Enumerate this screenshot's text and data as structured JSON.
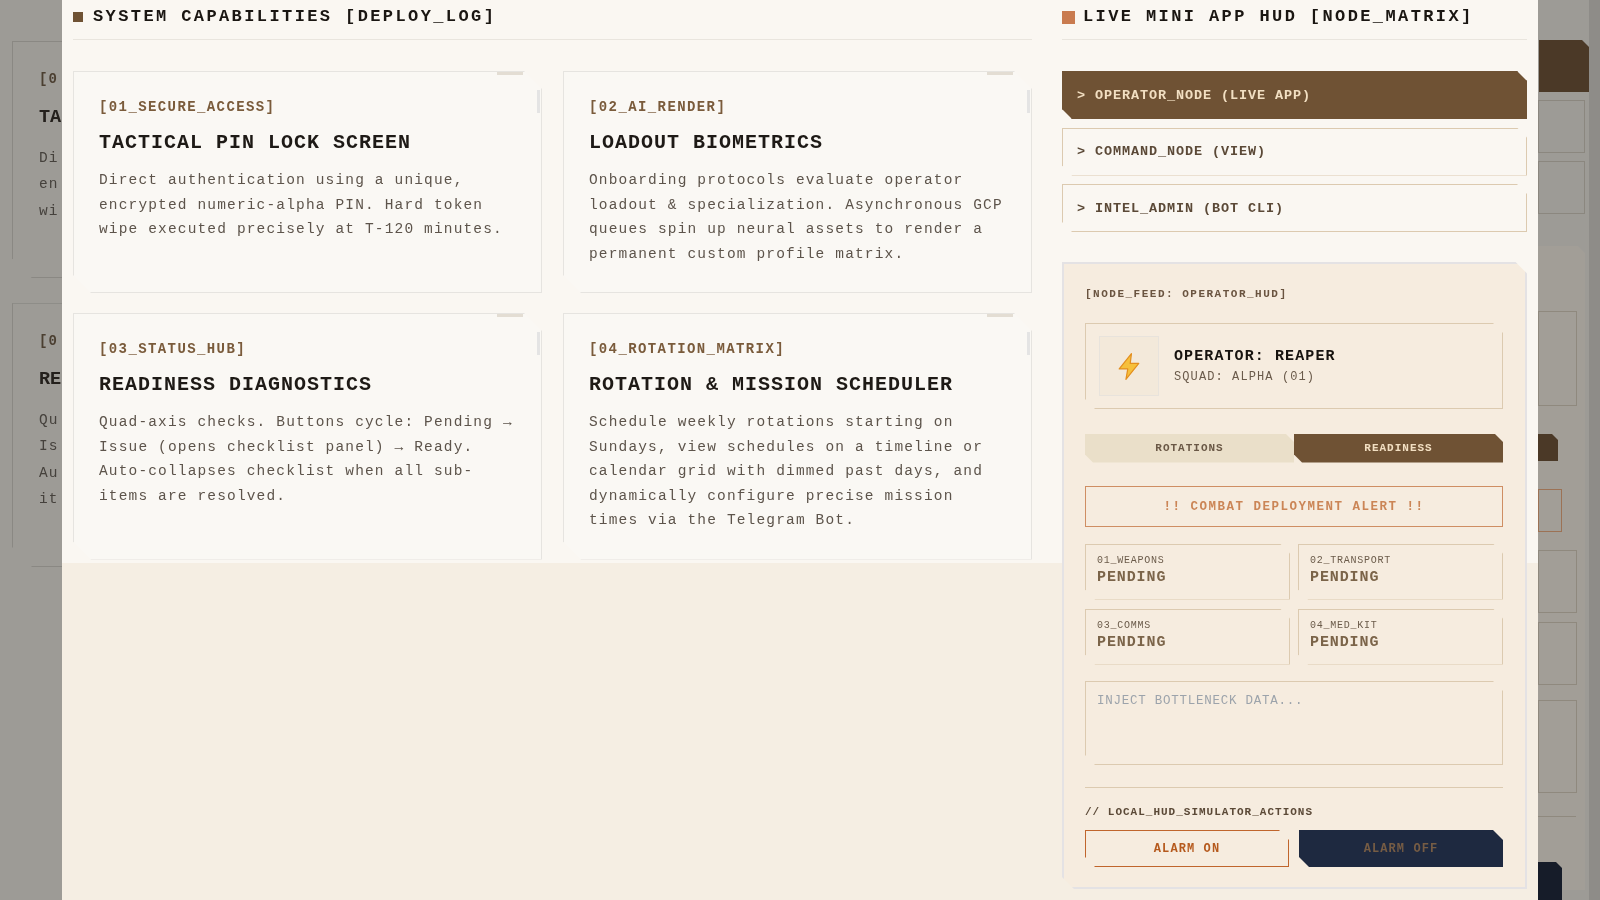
{
  "background_page": {
    "cards": [
      {
        "label": "[0",
        "title": "TA",
        "text_lines": [
          "Di",
          "en",
          "wi"
        ]
      },
      {
        "label": "[0",
        "title": "RE",
        "text_lines": [
          "Qu",
          "Is",
          "Au",
          "it"
        ]
      }
    ]
  },
  "capabilities": {
    "title": "SYSTEM CAPABILITIES [DEPLOY_LOG]",
    "cards": [
      {
        "tag": "[01_SECURE_ACCESS]",
        "title": "TACTICAL PIN LOCK SCREEN",
        "description": "Direct authentication using a unique, encrypted numeric-alpha PIN. Hard token wipe executed precisely at T-120 minutes."
      },
      {
        "tag": "[02_AI_RENDER]",
        "title": "LOADOUT BIOMETRICS",
        "description": "Onboarding protocols evaluate operator loadout & specialization. Asynchronous GCP queues spin up neural assets to render a permanent custom profile matrix."
      },
      {
        "tag": "[03_STATUS_HUB]",
        "title": "READINESS DIAGNOSTICS",
        "description": "Quad-axis checks. Buttons cycle: Pending → Issue (opens checklist panel) → Ready. Auto-collapses checklist when all sub-items are resolved."
      },
      {
        "tag": "[04_ROTATION_MATRIX]",
        "title": "ROTATION & MISSION SCHEDULER",
        "description": "Schedule weekly rotations starting on Sundays, view schedules on a timeline or calendar grid with dimmed past days, and dynamically configure precise mission times via the Telegram Bot."
      }
    ]
  },
  "hud": {
    "title": "LIVE MINI APP HUD [NODE_MATRIX]",
    "nodes": [
      {
        "label": "> OPERATOR_NODE (LIVE APP)",
        "selected": true
      },
      {
        "label": "> COMMAND_NODE (VIEW)",
        "selected": false
      },
      {
        "label": "> INTEL_ADMIN (BOT CLI)",
        "selected": false
      }
    ],
    "feed": {
      "label": "[NODE_FEED: OPERATOR_HUD]",
      "operator": {
        "name": "OPERATOR: REAPER",
        "squad": "SQUAD: ALPHA (01)"
      },
      "tabs": [
        {
          "label": "ROTATIONS",
          "selected": false
        },
        {
          "label": "READINESS",
          "selected": true
        }
      ],
      "alert": "!! COMBAT DEPLOYMENT ALERT !!",
      "checks": [
        {
          "label": "01_WEAPONS",
          "status": "PENDING"
        },
        {
          "label": "02_TRANSPORT",
          "status": "PENDING"
        },
        {
          "label": "03_COMMS",
          "status": "PENDING"
        },
        {
          "label": "04_MED_KIT",
          "status": "PENDING"
        }
      ],
      "notes": {
        "placeholder": "INJECT BOTTLENECK DATA..."
      },
      "actions_label": "// LOCAL_HUD_SIMULATOR_ACTIONS",
      "actions": [
        {
          "label": "ALARM ON",
          "kind": "outline"
        },
        {
          "label": "ALARM OFF",
          "kind": "solid"
        }
      ]
    }
  }
}
